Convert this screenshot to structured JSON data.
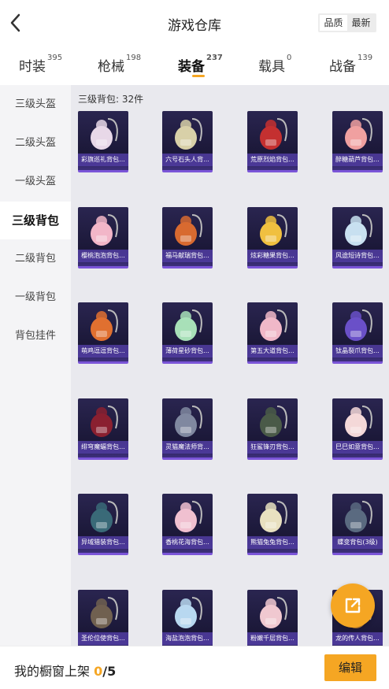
{
  "header": {
    "title": "游戏仓库",
    "sort_options": [
      "品质",
      "最新"
    ],
    "sort_selected": "品质"
  },
  "tabs": [
    {
      "label": "时装",
      "count": "395"
    },
    {
      "label": "枪械",
      "count": "198"
    },
    {
      "label": "装备",
      "count": "237"
    },
    {
      "label": "载具",
      "count": "0"
    },
    {
      "label": "战备",
      "count": "139"
    }
  ],
  "active_tab": "装备",
  "sidebar": {
    "items": [
      "三级头盔",
      "二级头盔",
      "一级头盔",
      "三级背包",
      "二级背包",
      "一级背包",
      "背包挂件"
    ],
    "active": "三级背包"
  },
  "section": {
    "title": "三级背包: 32件"
  },
  "items": [
    {
      "label": "彩旗巡礼背包...",
      "color": "#e8d8e8"
    },
    {
      "label": "六号石头人背...",
      "color": "#d8d0a8"
    },
    {
      "label": "荒原烈焰背包...",
      "color": "#c43030"
    },
    {
      "label": "醉糖葫芦背包...",
      "color": "#f0a0a0"
    },
    {
      "label": "樱桃泡泡背包...",
      "color": "#f2b6c8"
    },
    {
      "label": "福马献瑞背包...",
      "color": "#d86a30"
    },
    {
      "label": "炫彩糖果背包...",
      "color": "#f0c040"
    },
    {
      "label": "风途短诗背包...",
      "color": "#c8e0f0"
    },
    {
      "label": "萌鸡逗逗背包...",
      "color": "#e07030"
    },
    {
      "label": "薄荷星砂背包...",
      "color": "#a8e0b8"
    },
    {
      "label": "第五大道背包...",
      "color": "#f0b8c8"
    },
    {
      "label": "钛晶裂爪背包...",
      "color": "#6a50c8"
    },
    {
      "label": "绯穹魔蝠背包...",
      "color": "#8a2030"
    },
    {
      "label": "灵猫魔法师背...",
      "color": "#8088a0"
    },
    {
      "label": "狂鲨锋刃背包...",
      "color": "#4a5a48"
    },
    {
      "label": "巳巳如意背包...",
      "color": "#f4d8d8"
    },
    {
      "label": "异域猎装背包...",
      "color": "#3a6a78"
    },
    {
      "label": "香桃花海背包...",
      "color": "#f0c0d0"
    },
    {
      "label": "熊猫兔兔背包...",
      "color": "#e8e0c0"
    },
    {
      "label": "蝶变背包(3级)",
      "color": "#5a6a80"
    },
    {
      "label": "圣伦位使背包...",
      "color": "#706050"
    },
    {
      "label": "海盐泡泡背包...",
      "color": "#b8d8f0"
    },
    {
      "label": "粉嫩千层背包...",
      "color": "#f0c8d0"
    },
    {
      "label": "龙的传人背包...",
      "color": "#c88838"
    }
  ],
  "fab": {
    "icon": "share-external-icon"
  },
  "bottom": {
    "text": "我的橱窗上架",
    "count": "0",
    "total": "/5",
    "edit_label": "编辑"
  },
  "colors": {
    "accent": "#f5a623",
    "card_bg": "#1b1838",
    "card_label_bg": "#503ca0"
  }
}
